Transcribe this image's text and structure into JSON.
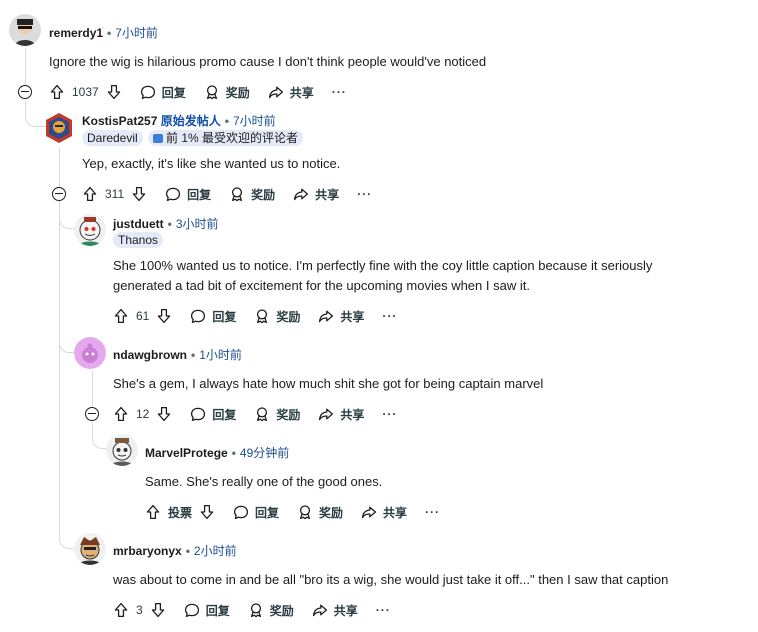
{
  "comments": [
    {
      "user": "remerdy1",
      "time": "7小时前",
      "text": "Ignore the wig is hilarious promo cause I don't think people would've noticed",
      "votes": "1037",
      "reply": "回复",
      "award": "奖励",
      "share": "共享",
      "more": "···"
    },
    {
      "user": "KostisPat257",
      "op_label": "原始发帖人",
      "time": "7小时前",
      "flair": "Daredevil",
      "badge": "前 1% 最受欢迎的评论者",
      "text": "Yep, exactly, it's like she wanted us to notice.",
      "votes": "311",
      "reply": "回复",
      "award": "奖励",
      "share": "共享",
      "more": "···"
    },
    {
      "user": "justduett",
      "time": "3小时前",
      "flair": "Thanos",
      "text_lines": [
        "She 100% wanted us to notice. I'm perfectly fine with the coy little caption because it seriously",
        "generated a tad bit of excitement for the upcoming movies when I saw it."
      ],
      "votes": "61",
      "reply": "回复",
      "award": "奖励",
      "share": "共享",
      "more": "···"
    },
    {
      "user": "ndawgbrown",
      "time": "1小时前",
      "text": "She's a gem, I always hate how much shit she got for being captain marvel",
      "votes": "12",
      "reply": "回复",
      "award": "奖励",
      "share": "共享",
      "more": "···"
    },
    {
      "user": "MarvelProtege",
      "time": "49分钟前",
      "text": "Same. She's really one of the good ones.",
      "votes": "投票",
      "reply": "回复",
      "award": "奖励",
      "share": "共享",
      "more": "···"
    },
    {
      "user": "mrbaryonyx",
      "time": "2小时前",
      "text": "was about to come in and be all \"bro its a wig, she would just take it off...\" then I saw that caption",
      "votes": "3",
      "reply": "回复",
      "award": "奖励",
      "share": "共享",
      "more": "···"
    }
  ],
  "separator": "•",
  "colors": {
    "accent": "#0f4fa8",
    "link": "#1d4f91",
    "flair_bg": "#e4eaf7",
    "thread_line": "#d6dadc"
  }
}
